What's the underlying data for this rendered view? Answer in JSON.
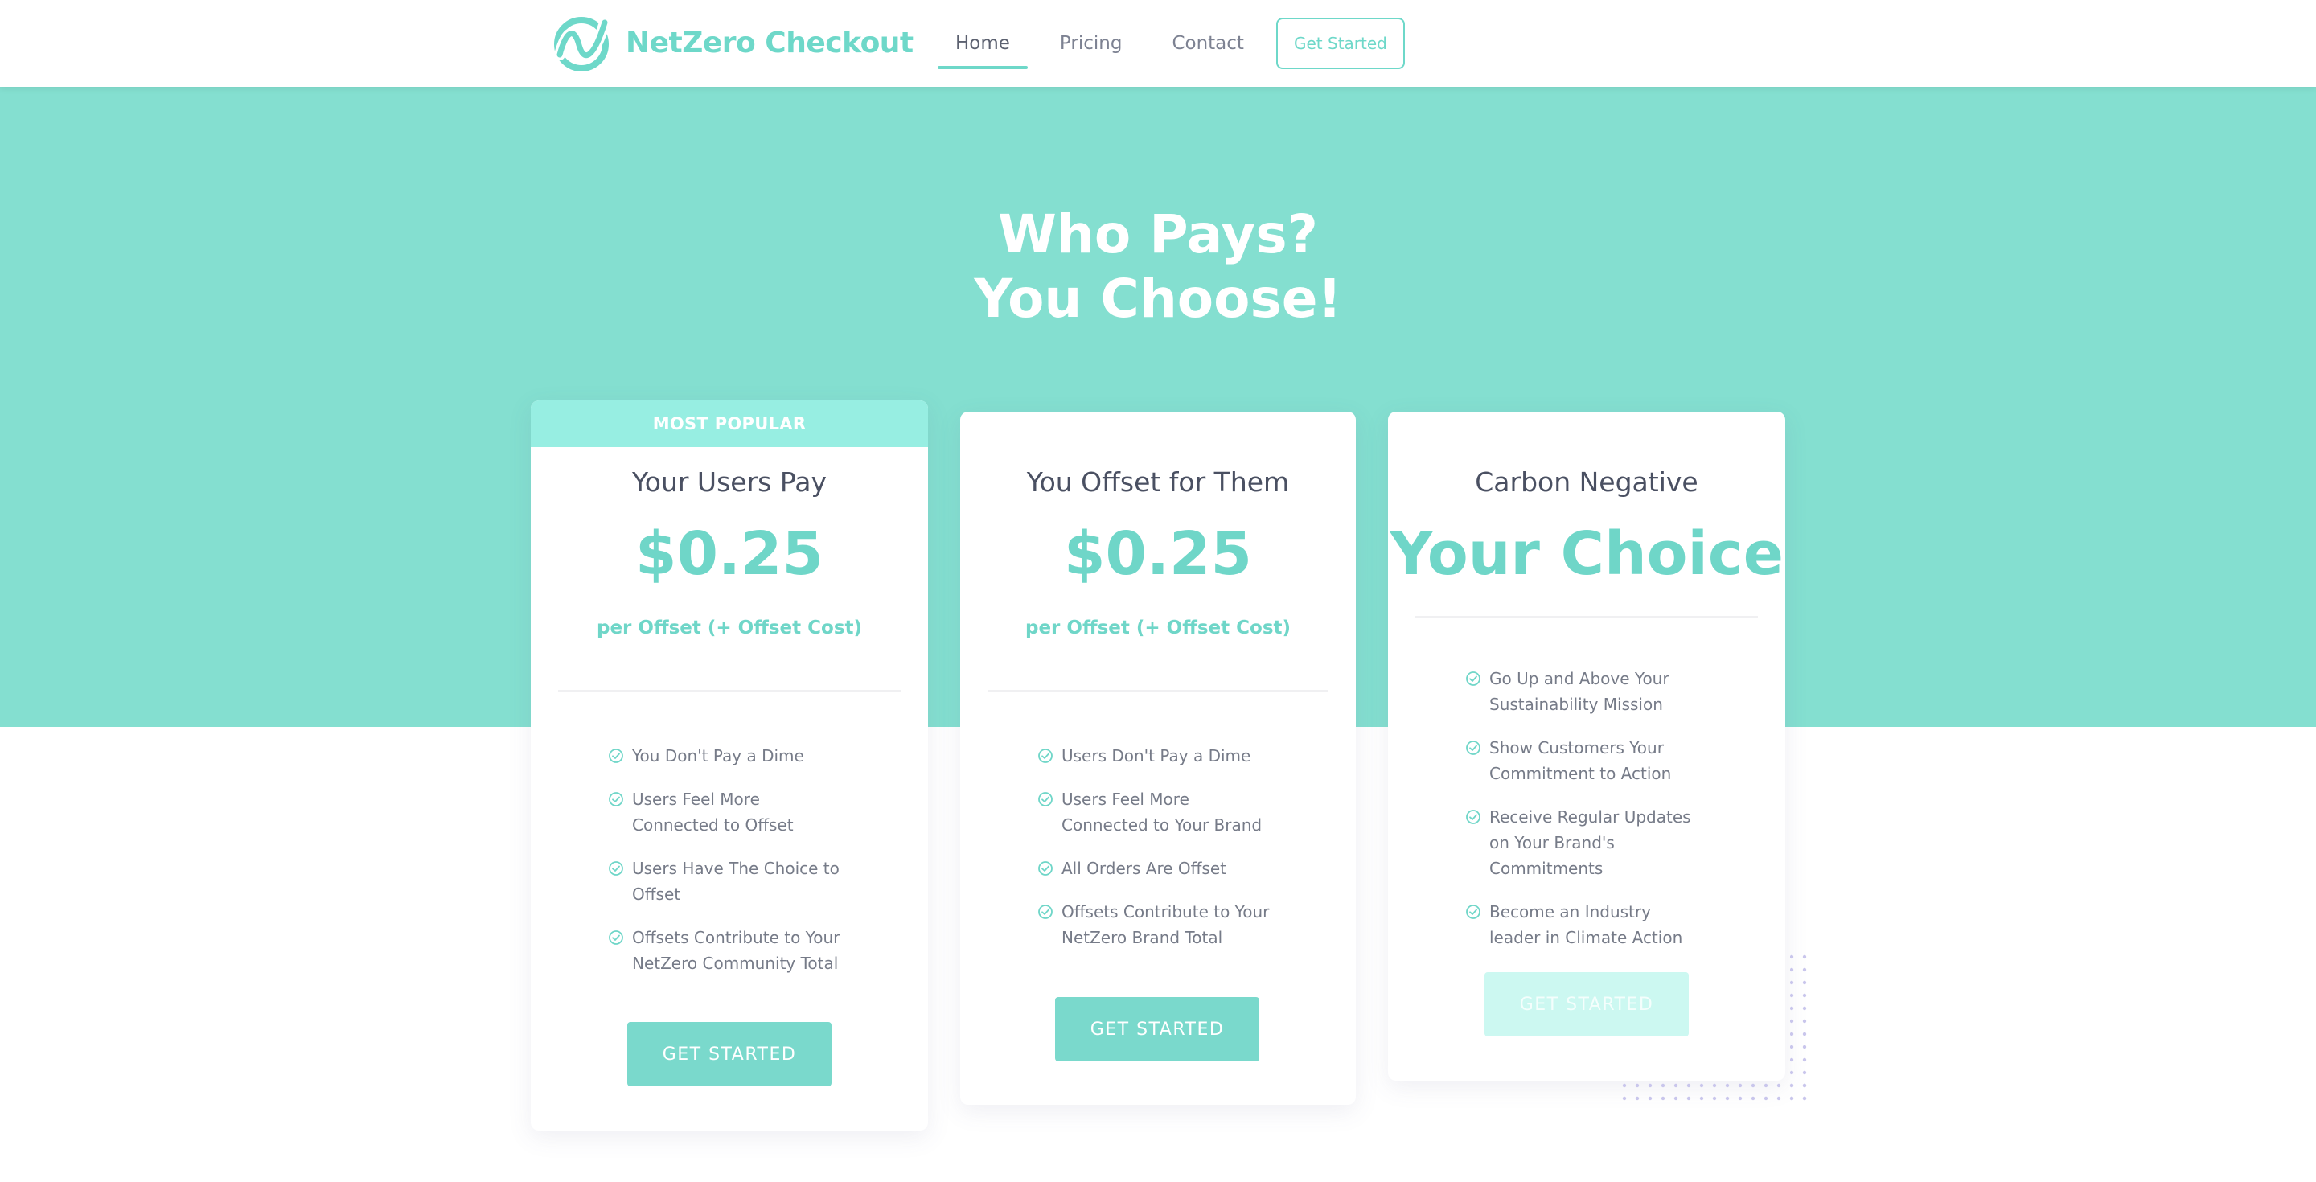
{
  "brand": {
    "name": "NetZero Checkout",
    "accent": "#6ed8c9",
    "hero_bg": "#84dfd0"
  },
  "nav": {
    "links": [
      "Home",
      "Pricing",
      "Contact"
    ],
    "active": "Home",
    "cta": "Get Started"
  },
  "hero": {
    "title_line1": "Who Pays?",
    "title_line2": "You Choose!"
  },
  "plans": [
    {
      "badge": "MOST POPULAR",
      "name": "Your Users Pay",
      "price": "$0.25",
      "price_sub": "per Offset (+ Offset Cost)",
      "features": [
        "You Don't Pay a Dime",
        "Users Feel More Connected to Offset",
        "Users Have The Choice to Offset",
        "Offsets Contribute to Your NetZero Community Total"
      ],
      "button": "GET STARTED"
    },
    {
      "name": "You Offset for Them",
      "price": "$0.25",
      "price_sub": "per Offset (+ Offset Cost)",
      "features": [
        "Users Don't Pay a Dime",
        "Users Feel More Connected to Your Brand",
        "All Orders Are Offset",
        "Offsets Contribute to Your NetZero Brand Total"
      ],
      "button": "GET STARTED"
    },
    {
      "name": "Carbon Negative",
      "price": "Your Choice",
      "features": [
        "Go Up and Above Your Sustainability Mission",
        "Show Customers Your Commitment to Action",
        "Receive Regular Updates on Your Brand's Commitments",
        "Become an Industry leader in Climate Action"
      ],
      "button": "GET STARTED"
    }
  ]
}
